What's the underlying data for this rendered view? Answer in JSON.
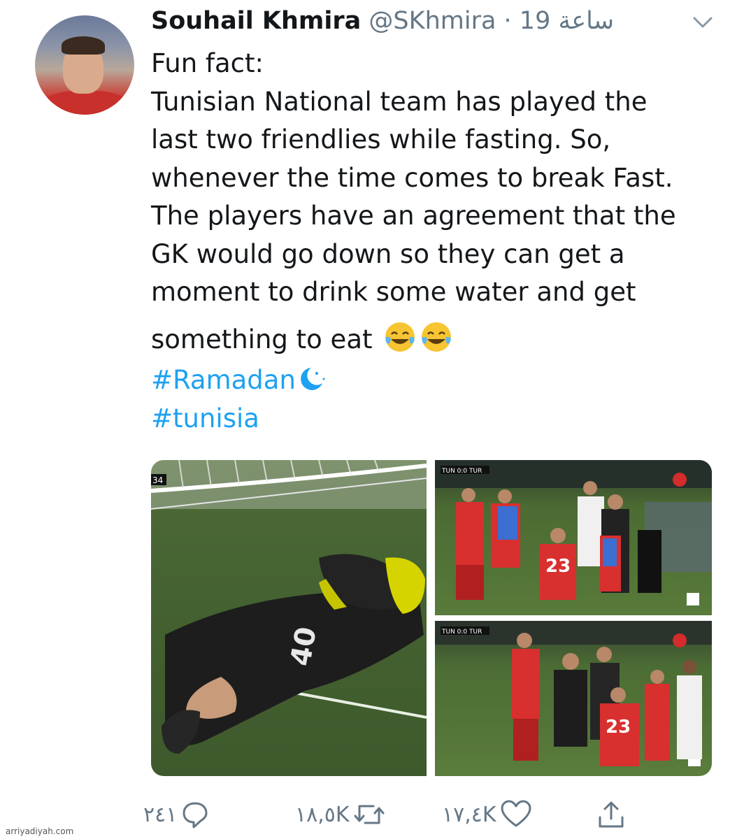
{
  "tweet": {
    "author_name": "Souhail Khmira",
    "handle_time": "@SKhmira · 19 ساعة",
    "text_lines": [
      "Fun fact:",
      "Tunisian National team has played the",
      "last two friendlies while fasting. So,",
      "whenever the time comes to break Fast.",
      "The players have an agreement that the",
      "GK would go down so they can get a",
      "moment to drink some water and get",
      "something to eat"
    ],
    "hashtags": [
      "#Ramadan",
      "#tunisia"
    ]
  },
  "media": {
    "left_jersey_number": "40",
    "top_right_jersey_number": "23",
    "bottom_right_jersey_number": "23",
    "scorebug_top": "TUN 0:0 TUR",
    "scorebug_bottom": "TUN 0:0 TUR",
    "timer_left": "34"
  },
  "actions": {
    "reply_count": "٢٤١",
    "retweet_count": "١٨,٥K",
    "like_count": "١٧,٤K"
  },
  "footer": {
    "credit": "arriyadiyah.com"
  },
  "colors": {
    "link": "#1da1f2",
    "muted": "#657786",
    "text": "#14171a"
  }
}
